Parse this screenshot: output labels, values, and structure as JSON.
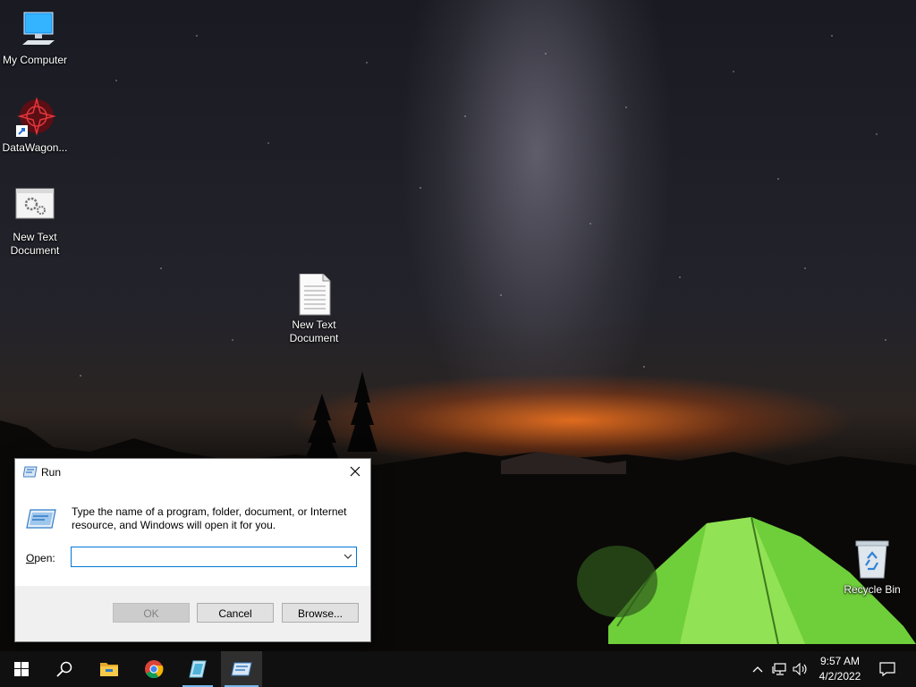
{
  "desktop": {
    "icons": [
      {
        "label": "My Computer"
      },
      {
        "label": "DataWagon..."
      },
      {
        "label": "New Text Document"
      },
      {
        "label": "New Text Document"
      },
      {
        "label": "Recycle Bin"
      }
    ]
  },
  "run_dialog": {
    "title": "Run",
    "description": "Type the name of a program, folder, document, or Internet resource, and Windows will open it for you.",
    "open_label_accel": "O",
    "open_label_rest": "pen:",
    "open_value": "",
    "ok_label": "OK",
    "cancel_label": "Cancel",
    "browse_label": "Browse..."
  },
  "taskbar": {
    "apps": [
      {
        "icon": "start-windows-icon"
      },
      {
        "icon": "search-icon"
      },
      {
        "icon": "file-explorer-icon"
      },
      {
        "icon": "chrome-icon"
      },
      {
        "icon": "app-icon"
      },
      {
        "icon": "run-icon",
        "active": true
      }
    ],
    "clock_time": "9:57 AM",
    "clock_date": "4/2/2022",
    "accent_color": "#76b9ed"
  }
}
